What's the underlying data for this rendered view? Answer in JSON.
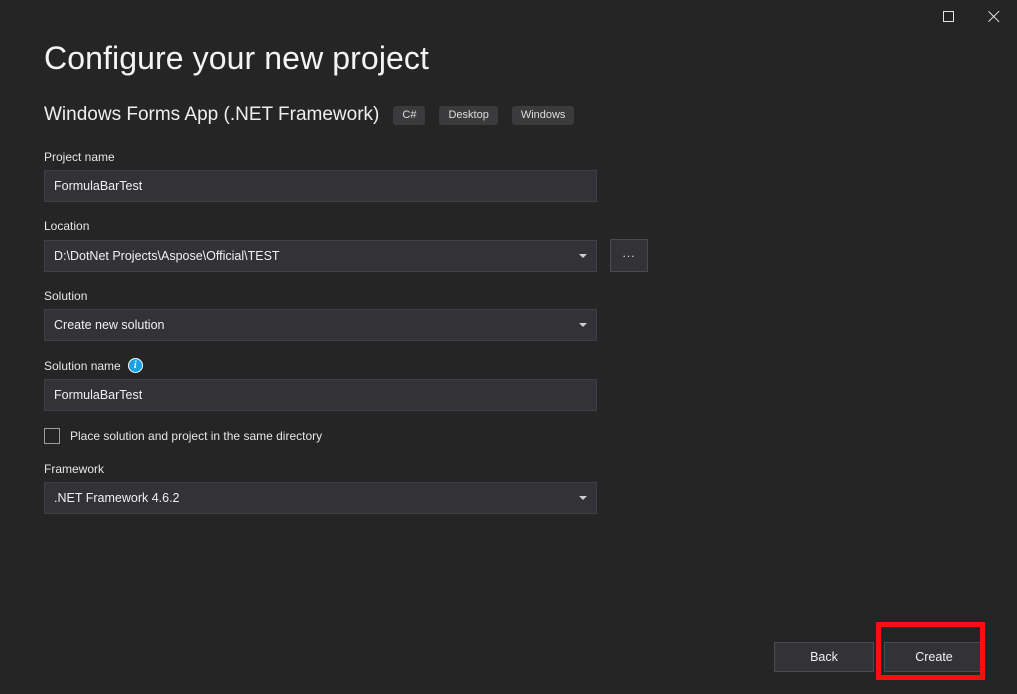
{
  "window": {
    "maximize_label": "Maximize",
    "close_label": "Close"
  },
  "header": {
    "title": "Configure your new project",
    "subtitle": "Windows Forms App (.NET Framework)",
    "tags": [
      "C#",
      "Desktop",
      "Windows"
    ]
  },
  "form": {
    "project_name": {
      "label": "Project name",
      "value": "FormulaBarTest",
      "placeholder": "Project name"
    },
    "location": {
      "label": "Location",
      "value": "D:\\DotNet Projects\\Aspose\\Official\\TEST",
      "browse_label": "..."
    },
    "solution": {
      "label": "Solution",
      "value": "Create new solution"
    },
    "solution_name": {
      "label": "Solution name",
      "info_glyph": "i",
      "value": "FormulaBarTest",
      "placeholder": "Solution name"
    },
    "same_directory": {
      "label": "Place solution and project in the same directory",
      "checked": false
    },
    "framework": {
      "label": "Framework",
      "value": ".NET Framework 4.6.2"
    }
  },
  "footer": {
    "back_label": "Back",
    "create_label": "Create"
  },
  "annotation": {
    "highlight_color": "#fa0f0f",
    "target": "create-button"
  },
  "colors": {
    "background": "#252526",
    "field_background": "#333337",
    "accent_info": "#1ba1e2",
    "text": "#f0f0f0"
  }
}
